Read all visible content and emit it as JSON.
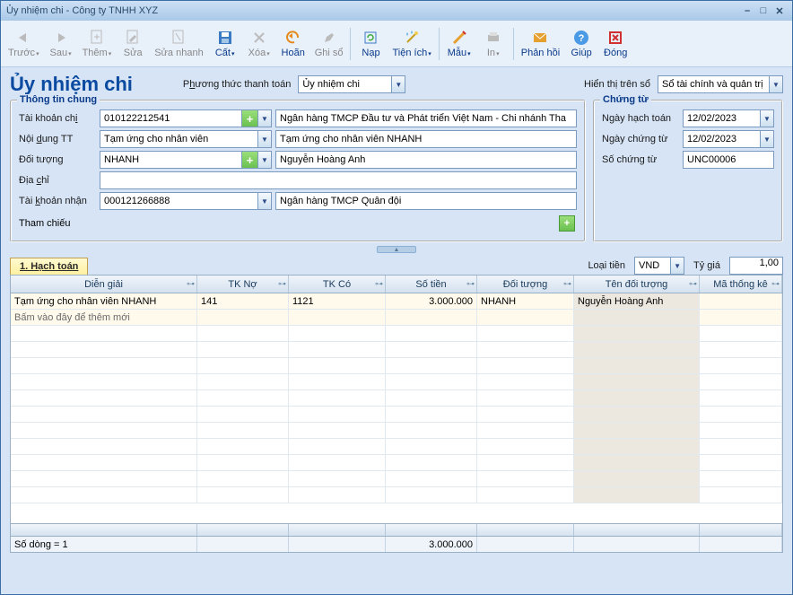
{
  "window": {
    "title": "Ủy nhiệm chi - Công ty TNHH XYZ"
  },
  "toolbar": {
    "prev": "Trước",
    "next": "Sau",
    "add": "Thêm",
    "edit": "Sửa",
    "quickedit": "Sửa nhanh",
    "cut": "Cất",
    "del": "Xóa",
    "undo": "Hoãn",
    "post": "Ghi sổ",
    "load": "Nạp",
    "util": "Tiện ích",
    "tmpl": "Mẫu",
    "print": "In",
    "feedback": "Phản hồi",
    "help": "Giúp",
    "close": "Đóng"
  },
  "header": {
    "title": "Ủy nhiệm chi",
    "paymethod_lbl": "Phương thức thanh toán",
    "paymethod_val": "Ủy nhiệm chi",
    "display_lbl": "Hiển thị trên sổ",
    "display_val": "Sổ tài chính và quản trị"
  },
  "general": {
    "legend": "Thông tin chung",
    "acct_pay_lbl": "Tài khoản chi",
    "acct_pay_val": "010122212541",
    "bank_pay": "Ngân hàng TMCP Đầu tư và Phát triển Việt Nam - Chi nhánh Tha",
    "content_lbl": "Nội dung TT",
    "content_val": "Tạm ứng cho nhân viên",
    "content_full": "Tạm ứng cho nhân viên NHANH",
    "subject_lbl": "Đối tượng",
    "subject_code": "NHANH",
    "subject_name": "Nguyễn Hoàng Anh",
    "addr_lbl": "Địa chỉ",
    "addr_val": "",
    "acct_recv_lbl": "Tài khoản nhận",
    "acct_recv_val": "000121266888",
    "bank_recv": "Ngân hàng TMCP Quân đội",
    "ref_lbl": "Tham chiếu"
  },
  "voucher": {
    "legend": "Chứng từ",
    "postdate_lbl": "Ngày hạch toán",
    "postdate_val": "12/02/2023",
    "vdate_lbl": "Ngày chứng từ",
    "vdate_val": "12/02/2023",
    "vno_lbl": "Số chứng từ",
    "vno_val": "UNC00006"
  },
  "tabs": {
    "t1": "1. Hạch toán"
  },
  "currency": {
    "lbl": "Loại tiền",
    "val": "VND",
    "rate_lbl": "Tỷ giá",
    "rate_val": "1,00"
  },
  "grid": {
    "cols": {
      "c1": "Diễn giải",
      "c2": "TK Nợ",
      "c3": "TK Có",
      "c4": "Số tiền",
      "c5": "Đối tượng",
      "c6": "Tên đối tượng",
      "c7": "Mã thống kê"
    },
    "row1": {
      "c1": "Tạm ứng cho nhân viên NHANH",
      "c2": "141",
      "c3": "1121",
      "c4": "3.000.000",
      "c5": "NHANH",
      "c6": "Nguyễn Hoàng Anh",
      "c7": ""
    },
    "newrow": "Bấm vào đây để thêm mới",
    "footer": {
      "rows": "Số dòng = 1",
      "sum": "3.000.000"
    }
  }
}
